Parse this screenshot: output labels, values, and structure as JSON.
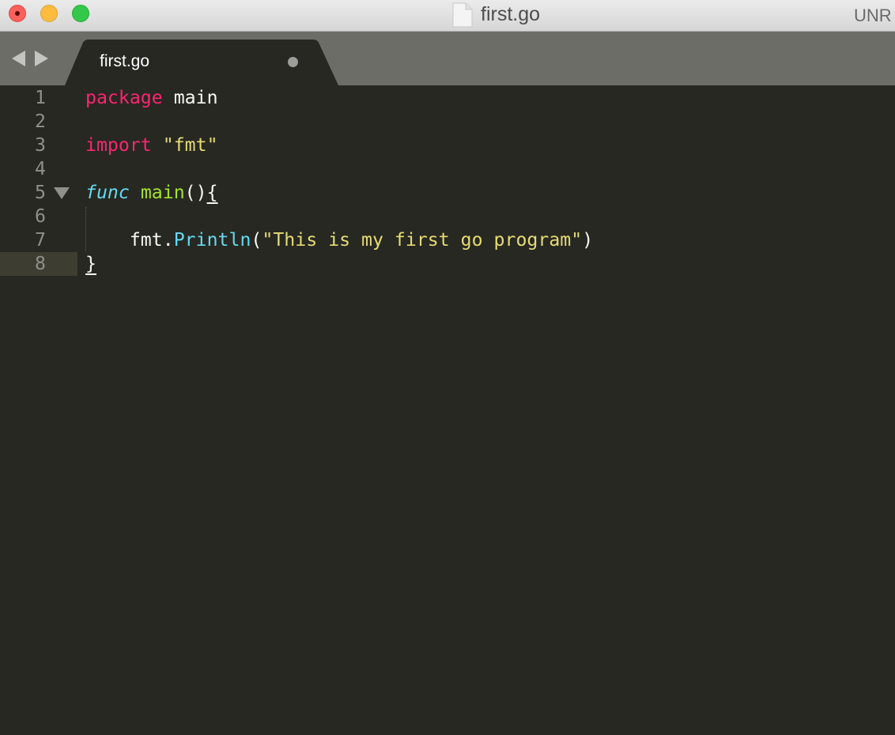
{
  "window": {
    "title": "first.go",
    "right_text": "UNR"
  },
  "tab": {
    "label": "first.go",
    "modified": true
  },
  "colors": {
    "keyword": "#f92672",
    "string": "#e6db74",
    "storage": "#66d9ef",
    "function": "#a6e22e",
    "plain": "#f8f8f2",
    "background": "#272822"
  },
  "editor": {
    "current_line": 8,
    "lines": [
      {
        "num": "1",
        "tokens": [
          {
            "t": "package",
            "c": "keyword"
          },
          {
            "t": " main",
            "c": "plain"
          }
        ]
      },
      {
        "num": "2",
        "tokens": []
      },
      {
        "num": "3",
        "tokens": [
          {
            "t": "import",
            "c": "keyword"
          },
          {
            "t": " ",
            "c": "plain"
          },
          {
            "t": "\"fmt\"",
            "c": "string"
          }
        ]
      },
      {
        "num": "4",
        "tokens": []
      },
      {
        "num": "5",
        "fold": true,
        "tokens": [
          {
            "t": "func",
            "c": "storage",
            "italic": true
          },
          {
            "t": " ",
            "c": "plain"
          },
          {
            "t": "main",
            "c": "function"
          },
          {
            "t": "()",
            "c": "plain"
          },
          {
            "t": "{",
            "c": "plain",
            "underline": true
          }
        ]
      },
      {
        "num": "6",
        "tokens": []
      },
      {
        "num": "7",
        "tokens": [
          {
            "t": "    fmt.",
            "c": "plain"
          },
          {
            "t": "Println",
            "c": "storage"
          },
          {
            "t": "(",
            "c": "plain"
          },
          {
            "t": "\"This is my first go program\"",
            "c": "string"
          },
          {
            "t": ")",
            "c": "plain"
          }
        ]
      },
      {
        "num": "8",
        "tokens": [
          {
            "t": "}",
            "c": "plain",
            "underline": true
          }
        ]
      }
    ]
  }
}
